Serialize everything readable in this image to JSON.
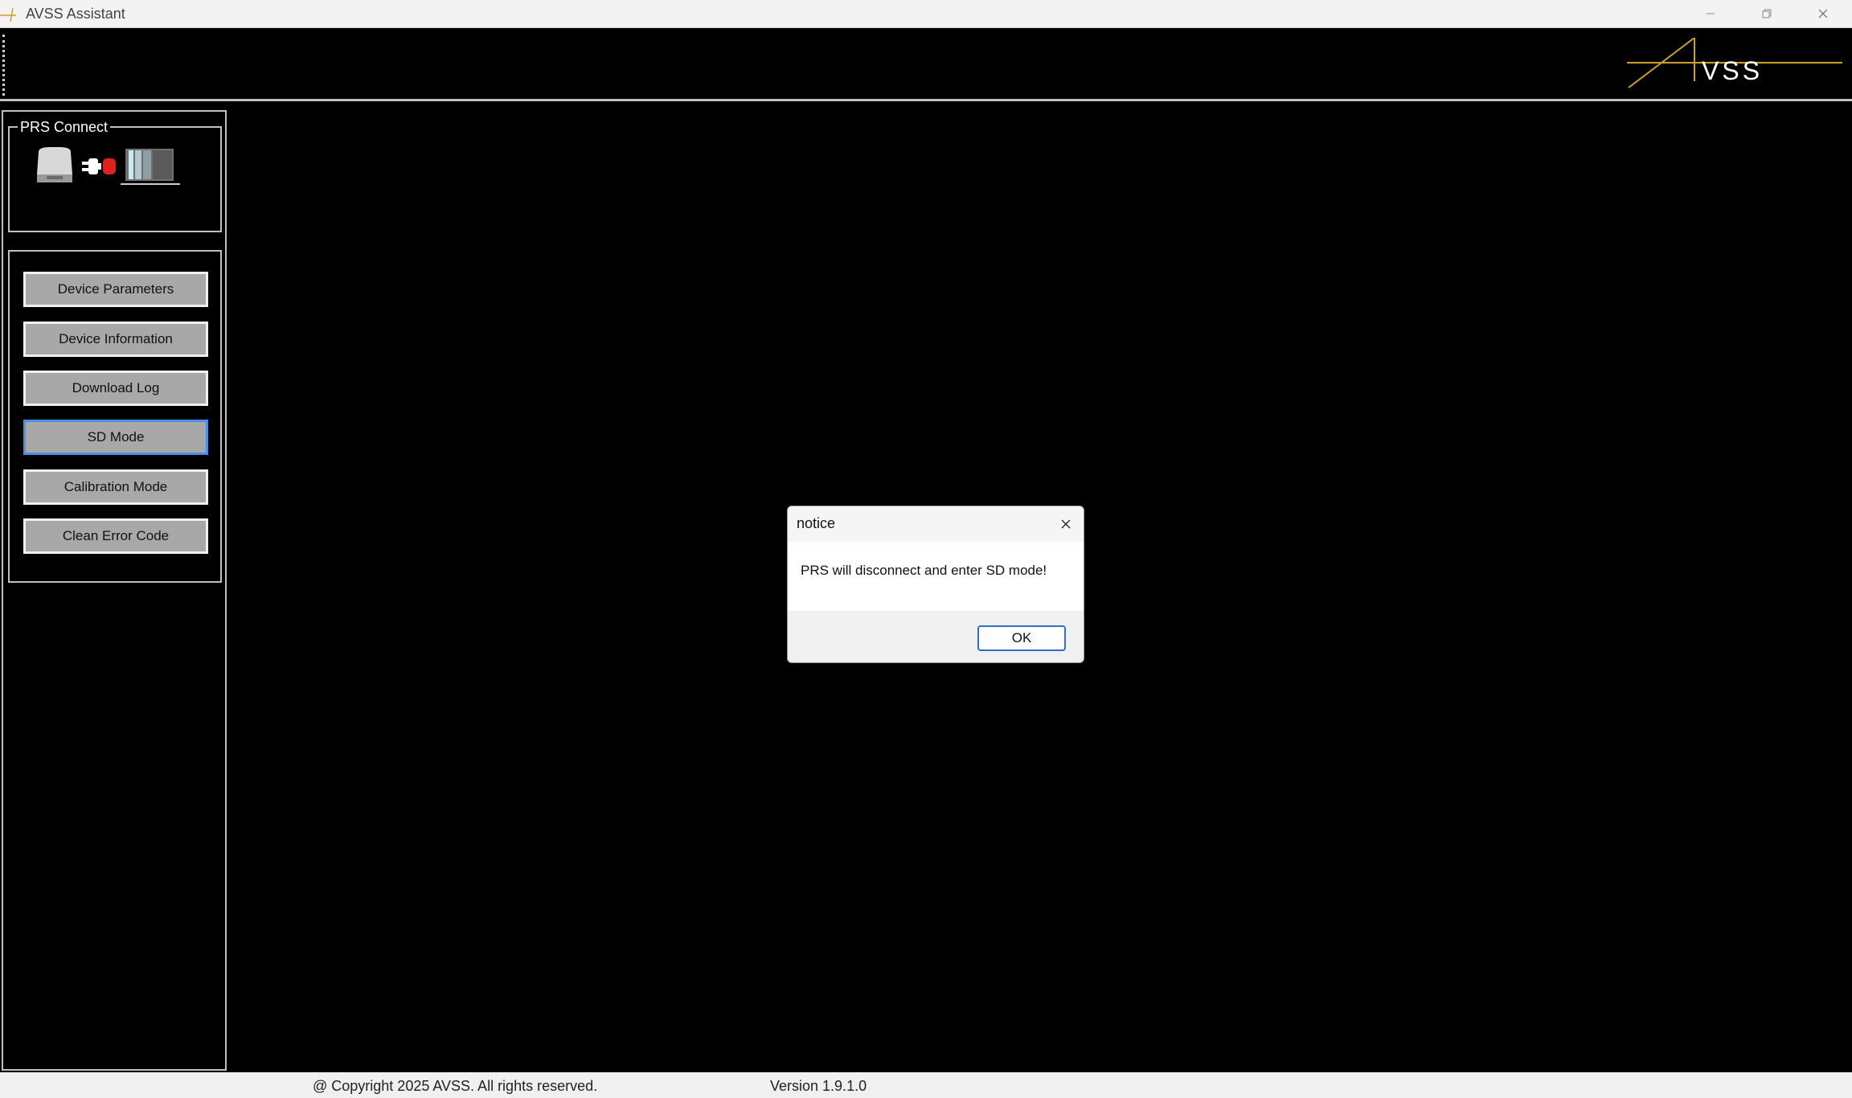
{
  "window": {
    "title": "AVSS Assistant"
  },
  "logo": {
    "text": "VSS",
    "line_color": "#c9a227"
  },
  "prs_connect": {
    "label": "PRS Connect",
    "status_color": "#e02020"
  },
  "sidebar": {
    "buttons": [
      {
        "label": "Device Parameters"
      },
      {
        "label": "Device Information"
      },
      {
        "label": "Download Log"
      },
      {
        "label": "SD Mode"
      },
      {
        "label": "Calibration Mode"
      },
      {
        "label": "Clean Error Code"
      }
    ]
  },
  "footer": {
    "copyright": "@ Copyright 2025 AVSS. All rights reserved.",
    "version": "Version 1.9.1.0"
  },
  "dialog": {
    "title": "notice",
    "message": "PRS will disconnect and enter SD mode!",
    "ok_label": "OK"
  }
}
